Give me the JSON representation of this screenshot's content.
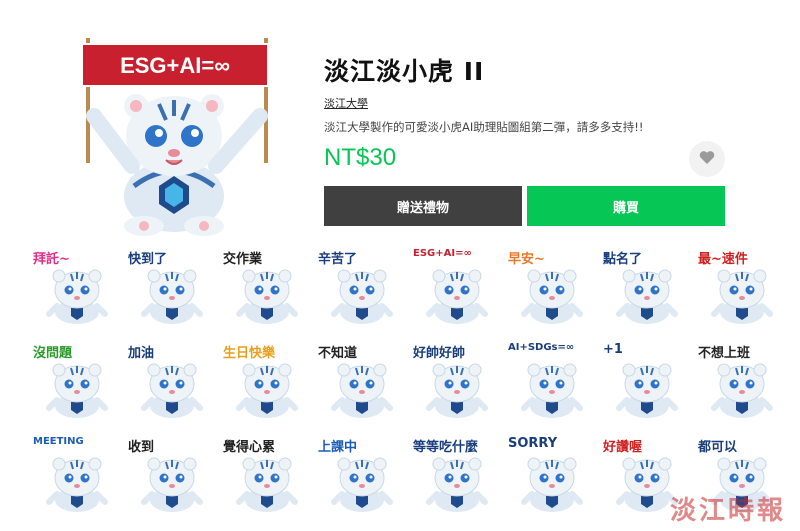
{
  "product": {
    "title": "淡江淡小虎 II",
    "author": "淡江大學",
    "description": "淡江大學製作的可愛淡小虎AI助理貼圖組第二彈，請多多支持!!",
    "price": "NT$30",
    "banner_text": "ESG+AI=∞"
  },
  "actions": {
    "gift_label": "贈送禮物",
    "buy_label": "購買"
  },
  "stickers": [
    {
      "caption": "拜託~",
      "color": "#e0318a"
    },
    {
      "caption": "快到了",
      "color": "#1a3d7c"
    },
    {
      "caption": "交作業",
      "color": "#222222"
    },
    {
      "caption": "辛苦了",
      "color": "#1a3d7c"
    },
    {
      "caption": "ESG+AI=∞",
      "color": "#c8202f"
    },
    {
      "caption": "早安~",
      "color": "#e8792b"
    },
    {
      "caption": "點名了",
      "color": "#1a3d7c"
    },
    {
      "caption": "最~速件",
      "color": "#d02020"
    },
    {
      "caption": "沒問題",
      "color": "#2a9a2a"
    },
    {
      "caption": "加油",
      "color": "#1a3d7c"
    },
    {
      "caption": "生日快樂",
      "color": "#e8a01b"
    },
    {
      "caption": "不知道",
      "color": "#222222"
    },
    {
      "caption": "好帥好帥",
      "color": "#1a3d7c"
    },
    {
      "caption": "AI+SDGs=∞",
      "color": "#1a3d7c"
    },
    {
      "caption": "+1",
      "color": "#1a3d7c"
    },
    {
      "caption": "不想上班",
      "color": "#222222"
    },
    {
      "caption": "MEETING",
      "color": "#1a5db8"
    },
    {
      "caption": "收到",
      "color": "#222222"
    },
    {
      "caption": "覺得心累",
      "color": "#222222"
    },
    {
      "caption": "上課中",
      "color": "#1a5db8"
    },
    {
      "caption": "等等吃什麼",
      "color": "#1a3d7c"
    },
    {
      "caption": "SORRY",
      "color": "#1a3d7c"
    },
    {
      "caption": "好讚喔",
      "color": "#d02020"
    },
    {
      "caption": "都可以",
      "color": "#1a3d7c"
    }
  ],
  "watermark": "淡江時報",
  "icons": {
    "favorite": "heart-icon"
  },
  "colors": {
    "accent": "#06c755",
    "dark_button": "#404040"
  }
}
